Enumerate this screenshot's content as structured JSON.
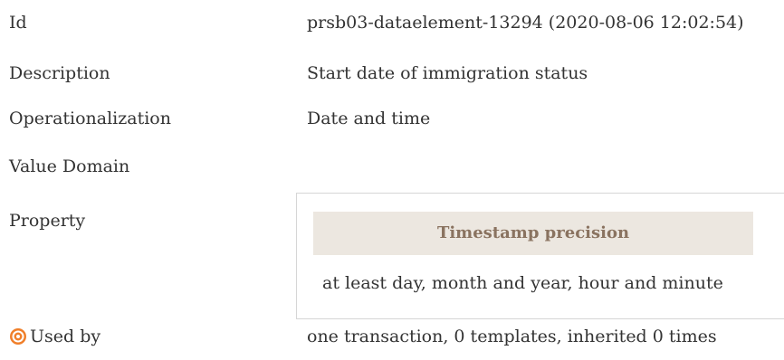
{
  "rows": {
    "id": {
      "label": "Id",
      "value": "prsb03-dataelement-13294 (2020-08-06 12:02:54)"
    },
    "description": {
      "label": "Description",
      "value": "Start date of immigration status"
    },
    "operationalization": {
      "label": "Operationalization",
      "value": "Date and time"
    },
    "value_domain": {
      "label": "Value Domain",
      "value": ""
    },
    "property": {
      "label": "Property",
      "header": "Timestamp precision",
      "value": "at least day, month and year, hour and minute"
    },
    "used_by": {
      "label": "Used by",
      "icon": "target-icon",
      "value": "one transaction, 0 templates, inherited 0 times"
    }
  },
  "colors": {
    "text": "#333333",
    "header_bg": "#ece7e0",
    "header_text": "#8a7360",
    "icon_orange": "#f07f2a"
  }
}
